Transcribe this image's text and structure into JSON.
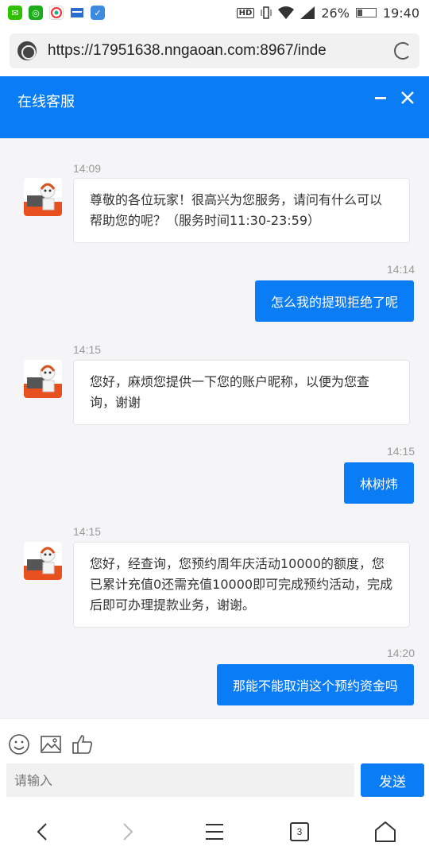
{
  "status_bar": {
    "battery": "26%",
    "battery_level": 0.26,
    "time": "19:40",
    "hd": "HD"
  },
  "browser": {
    "url": "https://17951638.nngaoan.com:8967/inde",
    "tab_count": "3"
  },
  "chat": {
    "title": "在线客服",
    "messages": [
      {
        "time": "14:09",
        "text": "尊敬的各位玩家！很高兴为您服务，请问有什么可以帮助您的呢？（服务时间11:30-23:59）"
      },
      {
        "time": "14:14",
        "text": "怎么我的提现拒绝了呢"
      },
      {
        "time": "14:15",
        "text": "您好，麻烦您提供一下您的账户昵称，以便为您查询，谢谢"
      },
      {
        "time": "14:15",
        "text": "林树炜"
      },
      {
        "time": "14:15",
        "text": "您好，经查询，您预约周年庆活动10000的额度，您已累计充值0还需充值10000即可完成预约活动，完成后即可办理提款业务，谢谢。"
      },
      {
        "time": "14:20",
        "text": "那能不能取消这个预约资金吗"
      }
    ]
  },
  "input": {
    "placeholder": "请输入",
    "send_label": "发送"
  },
  "colors": {
    "accent": "#0a7cf5",
    "chat_bg": "#f5f5f7"
  }
}
